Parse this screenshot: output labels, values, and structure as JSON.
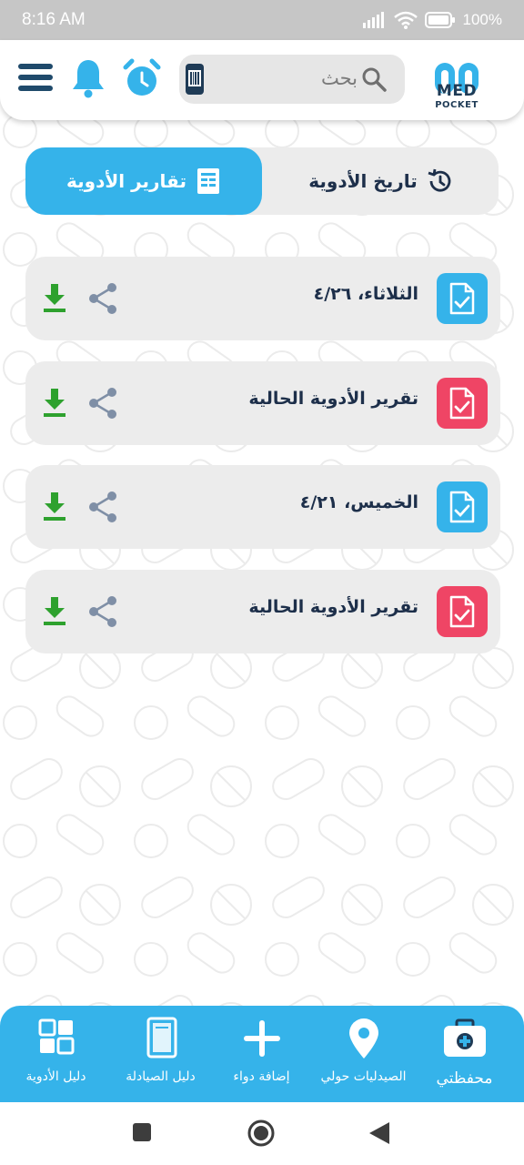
{
  "status_bar": {
    "time": "8:16 AM",
    "battery": "100%"
  },
  "header": {
    "search_placeholder": "بحث",
    "logo_line1": "MED",
    "logo_line2": "POCKET"
  },
  "tabs": [
    {
      "label": "تقارير الأدوية",
      "active": true,
      "icon": "report-icon"
    },
    {
      "label": "تاريخ الأدوية",
      "active": false,
      "icon": "history-icon"
    }
  ],
  "reports": [
    {
      "title": "الثلاثاء، ٤/٢٦",
      "badge_color": "#35b3ea"
    },
    {
      "title": "تقرير الأدوية الحالية",
      "badge_color": "#ef4565"
    },
    {
      "title": "الخميس، ٤/٢١",
      "badge_color": "#35b3ea"
    },
    {
      "title": "تقرير الأدوية الحالية",
      "badge_color": "#ef4565"
    }
  ],
  "bottom_nav": [
    {
      "label": "محفظتي",
      "icon": "medkit-icon"
    },
    {
      "label": "الصيدليات حولي",
      "icon": "location-pin-icon"
    },
    {
      "label": "إضافة دواء",
      "icon": "plus-icon"
    },
    {
      "label": "دليل الصيادلة",
      "icon": "book-icon"
    },
    {
      "label": "دليل الأدوية",
      "icon": "grid-icon"
    }
  ],
  "colors": {
    "accent": "#35b3ea",
    "dark_text": "#1d2f4a",
    "download": "#2ea12e",
    "share": "#7f8fa6",
    "badge_red": "#ef4565"
  }
}
